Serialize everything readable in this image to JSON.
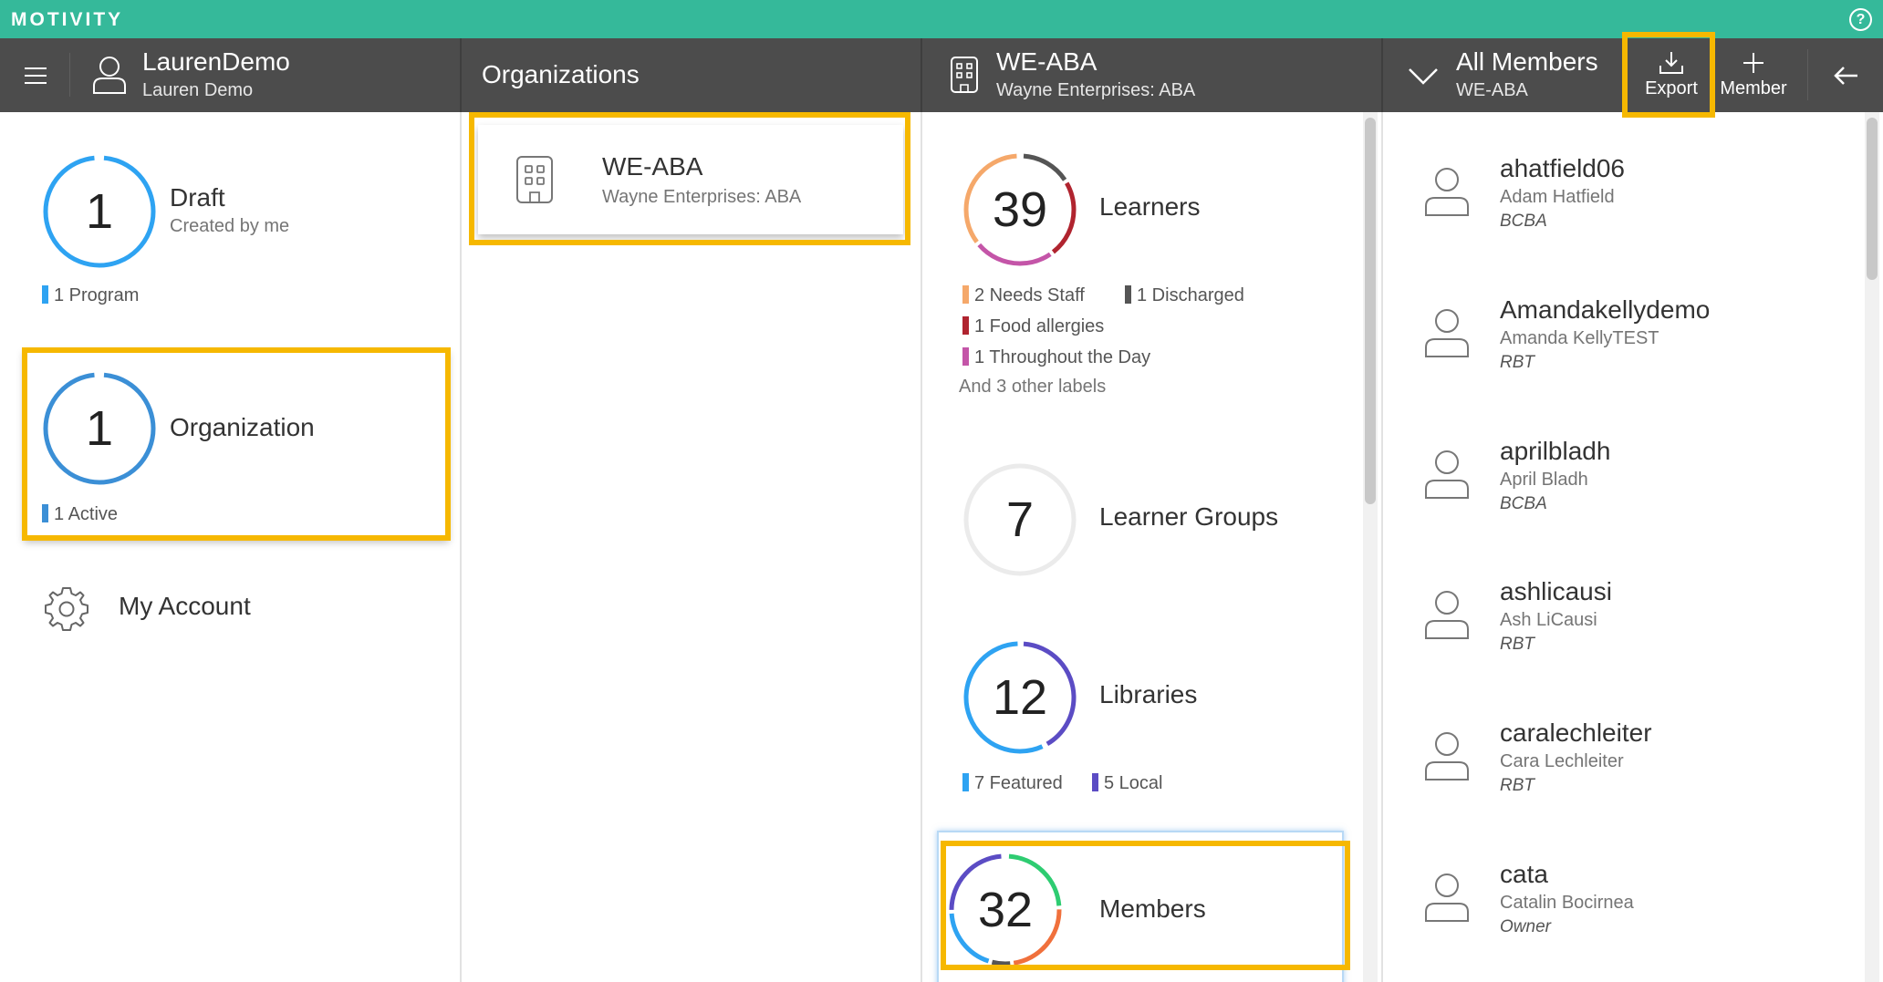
{
  "brand": {
    "logo": "MOTIVITY",
    "help_symbol": "?"
  },
  "header": {
    "user": {
      "username": "LaurenDemo",
      "full_name": "Lauren Demo"
    },
    "organizations_title": "Organizations",
    "org": {
      "code": "WE-ABA",
      "name": "Wayne Enterprises: ABA"
    },
    "members": {
      "title": "All Members",
      "subtitle": "WE-ABA",
      "export_label": "Export",
      "add_label": "Member"
    }
  },
  "home": {
    "draft": {
      "count": "1",
      "title": "Draft",
      "subtitle": "Created by me",
      "legend": "1 Program"
    },
    "organization": {
      "count": "1",
      "title": "Organization",
      "legend": "1 Active"
    },
    "account": {
      "label": "My Account"
    }
  },
  "organizations": [
    {
      "code": "WE-ABA",
      "name": "Wayne Enterprises: ABA"
    }
  ],
  "org_detail": {
    "learners": {
      "count": "39",
      "title": "Learners",
      "legends": [
        "2 Needs Staff",
        "1 Discharged",
        "1 Food allergies",
        "1 Throughout the Day"
      ],
      "more": "And 3 other labels"
    },
    "groups": {
      "count": "7",
      "title": "Learner Groups"
    },
    "libraries": {
      "count": "12",
      "title": "Libraries",
      "legends": [
        "7 Featured",
        "5 Local"
      ]
    },
    "members": {
      "count": "32",
      "title": "Members"
    }
  },
  "members_list": [
    {
      "username": "ahatfield06",
      "name": "Adam Hatfield",
      "role": "BCBA"
    },
    {
      "username": "Amandakellydemo",
      "name": "Amanda KellyTEST",
      "role": "RBT"
    },
    {
      "username": "aprilbladh",
      "name": "April Bladh",
      "role": "BCBA"
    },
    {
      "username": "ashlicausi",
      "name": "Ash LiCausi",
      "role": "RBT"
    },
    {
      "username": "caralechleiter",
      "name": "Cara Lechleiter",
      "role": "RBT"
    },
    {
      "username": "cata",
      "name": "Catalin Bocirnea",
      "role": "Owner"
    }
  ],
  "colors": {
    "brand": "#35b99a",
    "header": "#4c4c4c",
    "highlight": "#f6b800",
    "blue": "#2ea3f2",
    "orange": "#f5a86a",
    "dark": "#555555",
    "red": "#b0242f",
    "magenta": "#c455a8",
    "indigo": "#5b4cc4",
    "green": "#2ecc71",
    "coral": "#f0703c"
  }
}
